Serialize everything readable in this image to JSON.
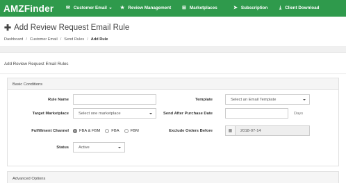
{
  "navbar": {
    "brand": "AMZFinder",
    "items": [
      {
        "label": "Customer Email",
        "icon": "envelope-icon",
        "dropdown": true
      },
      {
        "label": "Review Management",
        "icon": "star-icon"
      },
      {
        "label": "Marketplaces",
        "icon": "sitemap-icon"
      },
      {
        "label": "Subscription",
        "icon": "paper-plane-icon"
      },
      {
        "label": "Client Download",
        "icon": "download-icon"
      }
    ],
    "bg_color": "#2f9a4c"
  },
  "page": {
    "title": "Add Review Request Email Rule",
    "breadcrumb": [
      "Dashboard",
      "Customer Email",
      "Send Rules",
      "Add Rule"
    ]
  },
  "panel": {
    "title": "Add Review Request Email Rules"
  },
  "basic": {
    "header": "Basic Conditions",
    "rule_name_label": "Rule Name",
    "rule_name_value": "",
    "template_label": "Template",
    "template_value": "Select an Email Template",
    "target_marketplace_label": "Target Marketplace",
    "target_marketplace_value": "Select one marketplace",
    "send_after_label": "Send After Purchase Date",
    "send_after_value": "",
    "days_label": "Days",
    "fulfillment_label": "Fulfillment Channel",
    "fulfillment_options": [
      "FBA & FBM",
      "FBA",
      "FBM"
    ],
    "fulfillment_selected": "FBA & FBM",
    "exclude_label": "Exclude Orders Before",
    "exclude_value": "2018-07-14",
    "status_label": "Status",
    "status_value": "Active"
  },
  "advanced": {
    "header": "Advanced Options"
  }
}
